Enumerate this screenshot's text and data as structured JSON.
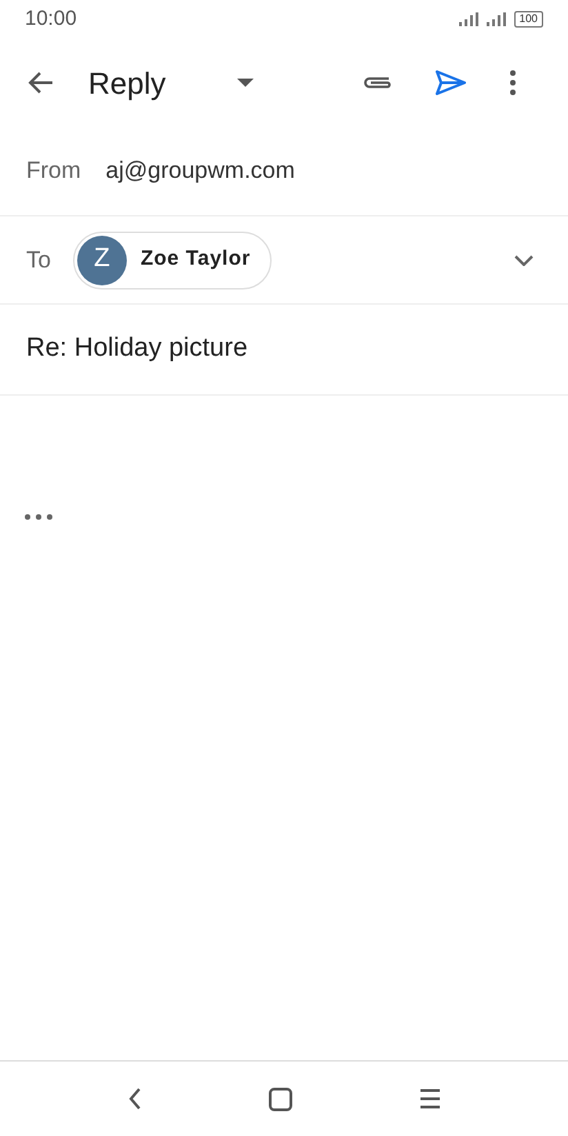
{
  "status_bar": {
    "time": "10:00",
    "battery": "100"
  },
  "toolbar": {
    "title": "Reply"
  },
  "from": {
    "label": "From",
    "value": "aj@groupwm.com"
  },
  "to": {
    "label": "To",
    "recipients": [
      {
        "initial": "Z",
        "name": "Zoe Taylor",
        "color": "#4f7394"
      }
    ]
  },
  "subject": {
    "value": "Re: Holiday picture"
  }
}
